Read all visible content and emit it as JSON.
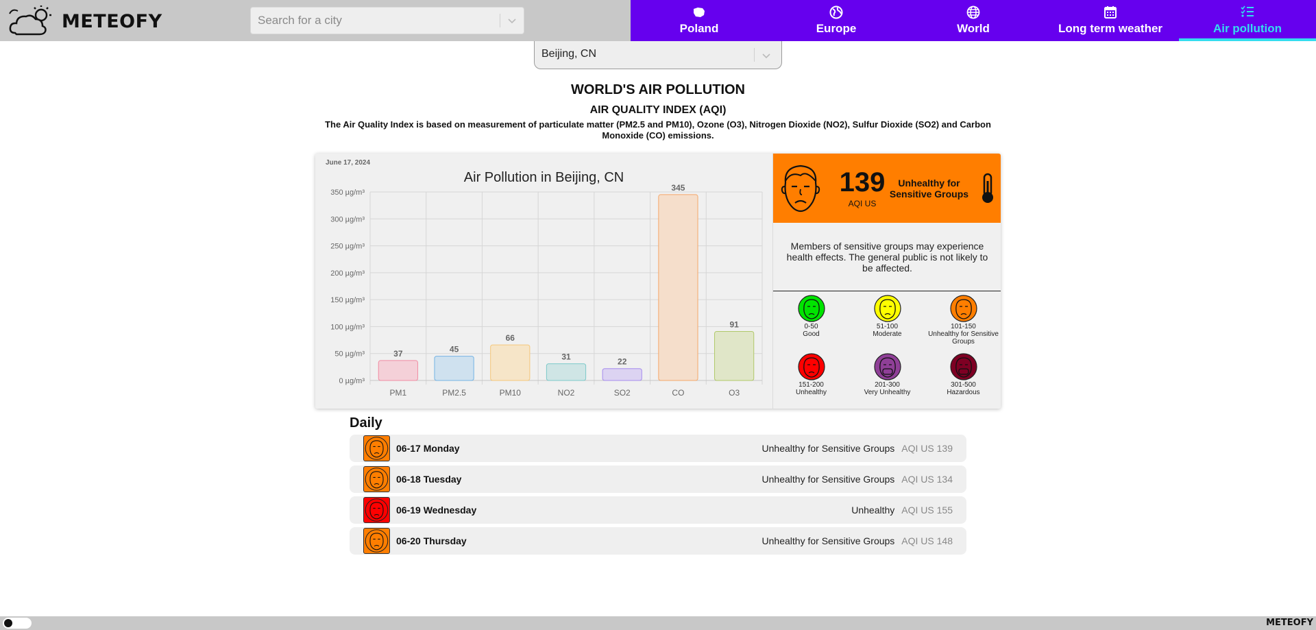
{
  "header": {
    "logo_text": "METEOFY",
    "search_placeholder": "Search for a city",
    "nav": [
      {
        "label": "Poland",
        "icon": "poland-map-icon",
        "active": false
      },
      {
        "label": "Europe",
        "icon": "globe-europe-icon",
        "active": false
      },
      {
        "label": "World",
        "icon": "globe-icon",
        "active": false
      },
      {
        "label": "Long term weather",
        "icon": "calendar-icon",
        "active": false
      },
      {
        "label": "Air pollution",
        "icon": "list-check-icon",
        "active": true
      }
    ]
  },
  "city_select": {
    "value": "Beijing, CN"
  },
  "page": {
    "title": "WORLD'S AIR POLLUTION",
    "aqi_title": "AIR QUALITY INDEX (AQI)",
    "aqi_description": "The Air Quality Index is based on measurement of particulate matter (PM2.5 and PM10), Ozone (O3), Nitrogen Dioxide (NO2), Sulfur Dioxide (SO2) and Carbon Monoxide (CO) emissions."
  },
  "chart_data": {
    "type": "bar",
    "date": "June 17, 2024",
    "title": "Air Pollution in Beijing, CN",
    "categories": [
      "PM1",
      "PM2.5",
      "PM10",
      "NO2",
      "SO2",
      "CO",
      "O3"
    ],
    "values": [
      37,
      45,
      66,
      31,
      22,
      345,
      91
    ],
    "y_ticks": [
      "0 µg/m³",
      "50 µg/m³",
      "100 µg/m³",
      "150 µg/m³",
      "200 µg/m³",
      "250 µg/m³",
      "300 µg/m³",
      "350 µg/m³"
    ],
    "ylim": [
      0,
      350
    ],
    "grid": true,
    "colors": [
      {
        "fill": "#f4d0d8",
        "stroke": "#f08ca2"
      },
      {
        "fill": "#cfe1ef",
        "stroke": "#74b3e3"
      },
      {
        "fill": "#f6e5c8",
        "stroke": "#f5c77a"
      },
      {
        "fill": "#cfe5e5",
        "stroke": "#7cc9c9"
      },
      {
        "fill": "#dcd3f2",
        "stroke": "#a68ced"
      },
      {
        "fill": "#f5decb",
        "stroke": "#f5a76a"
      },
      {
        "fill": "#e0e6c8",
        "stroke": "#b0c869"
      }
    ]
  },
  "aqi_current": {
    "value": "139",
    "unit": "AQI US",
    "category": "Unhealthy for Sensitive Groups",
    "color": "#ff7e00",
    "message": "Members of sensitive groups may experience health effects. The general public is not likely to be affected.",
    "face_icon": "sad-face-icon",
    "thermometer_icon": "thermometer-icon"
  },
  "aqi_legend": [
    {
      "range": "0-50",
      "label": "Good",
      "color": "#00e400"
    },
    {
      "range": "51-100",
      "label": "Moderate",
      "color": "#ffff00"
    },
    {
      "range": "101-150",
      "label": "Unhealthy for Sensitive Groups",
      "color": "#ff7e00"
    },
    {
      "range": "151-200",
      "label": "Unhealthy",
      "color": "#ff0000"
    },
    {
      "range": "201-300",
      "label": "Very Unhealthy",
      "color": "#8f3f97"
    },
    {
      "range": "301-500",
      "label": "Hazardous",
      "color": "#7e0023"
    }
  ],
  "daily": {
    "title": "Daily",
    "rows": [
      {
        "date": "06-17 Monday",
        "category": "Unhealthy for Sensitive Groups",
        "aqi": "AQI US 139",
        "color": "#ff7e00"
      },
      {
        "date": "06-18 Tuesday",
        "category": "Unhealthy for Sensitive Groups",
        "aqi": "AQI US 134",
        "color": "#ff7e00"
      },
      {
        "date": "06-19 Wednesday",
        "category": "Unhealthy",
        "aqi": "AQI US 155",
        "color": "#ff0000"
      },
      {
        "date": "06-20 Thursday",
        "category": "Unhealthy for Sensitive Groups",
        "aqi": "AQI US 148",
        "color": "#ff7e00"
      }
    ]
  },
  "footer": {
    "logo_text": "METEOFY",
    "theme_toggle": "theme-toggle"
  }
}
